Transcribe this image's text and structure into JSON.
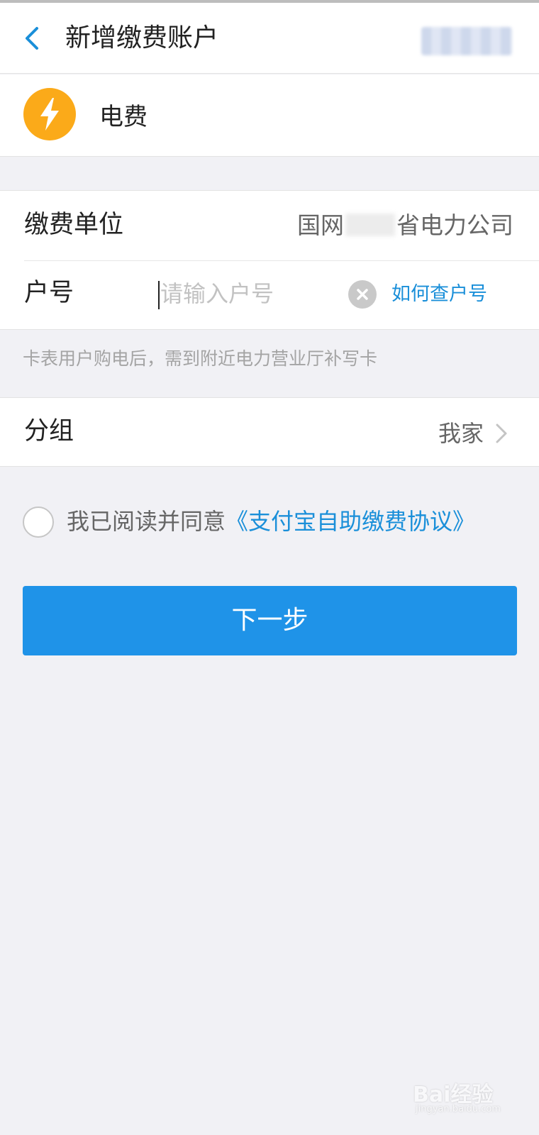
{
  "nav": {
    "title": "新增缴费账户"
  },
  "business": {
    "name": "电费",
    "icon": "lightning-bolt-icon",
    "icon_color": "#FBAA19"
  },
  "form": {
    "unit_label": "缴费单位",
    "unit_value_prefix": "国网",
    "unit_value_suffix": "省电力公司",
    "account_label": "户号",
    "account_placeholder": "请输入户号",
    "account_value": "",
    "how_to_find": "如何查户号"
  },
  "hint": "卡表用户购电后，需到附近电力营业厅补写卡",
  "group": {
    "label": "分组",
    "value": "我家"
  },
  "agreement": {
    "text": "我已阅读并同意",
    "link": "《支付宝自助缴费协议》",
    "checked": false
  },
  "next_button": "下一步",
  "colors": {
    "accent": "#1F93E8",
    "link": "#1A8FD9",
    "background": "#F1F1F5"
  },
  "watermark": {
    "logo": "Bai经验",
    "url": "jingyan.baidu.com"
  }
}
